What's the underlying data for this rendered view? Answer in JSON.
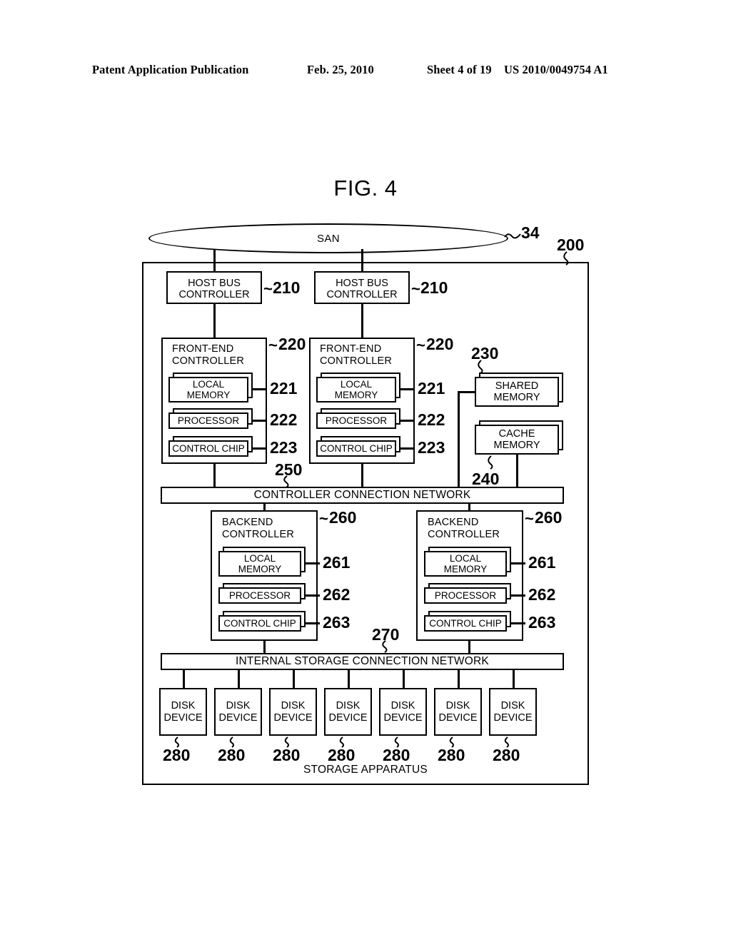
{
  "header": {
    "publication": "Patent Application Publication",
    "date": "Feb. 25, 2010",
    "sheet": "Sheet 4 of 19",
    "patent_number": "US 2010/0049754 A1"
  },
  "figure": {
    "title": "FIG. 4",
    "network_label": "SAN",
    "network_ref": "34",
    "apparatus_ref": "200",
    "apparatus_caption": "STORAGE APPARATUS"
  },
  "host_bus_controllers": [
    {
      "label": "HOST BUS\nCONTROLLER",
      "line1": "HOST BUS",
      "line2": "CONTROLLER",
      "ref": "210"
    },
    {
      "label": "HOST BUS\nCONTROLLER",
      "line1": "HOST BUS",
      "line2": "CONTROLLER",
      "ref": "210"
    }
  ],
  "front_end_controllers": [
    {
      "line1": "FRONT-END",
      "line2": "CONTROLLER",
      "ref": "220",
      "modules": [
        {
          "line1": "LOCAL",
          "line2": "MEMORY",
          "ref": "221"
        },
        {
          "line1": "PROCESSOR",
          "line2": "",
          "ref": "222"
        },
        {
          "line1": "CONTROL CHIP",
          "line2": "",
          "ref": "223"
        }
      ]
    },
    {
      "line1": "FRONT-END",
      "line2": "CONTROLLER",
      "ref": "220",
      "modules": [
        {
          "line1": "LOCAL",
          "line2": "MEMORY",
          "ref": "221"
        },
        {
          "line1": "PROCESSOR",
          "line2": "",
          "ref": "222"
        },
        {
          "line1": "CONTROL CHIP",
          "line2": "",
          "ref": "223"
        }
      ]
    }
  ],
  "memories": [
    {
      "line1": "SHARED",
      "line2": "MEMORY",
      "ref": "230"
    },
    {
      "line1": "CACHE",
      "line2": "MEMORY",
      "ref": "240"
    }
  ],
  "controller_network": {
    "label": "CONTROLLER CONNECTION NETWORK",
    "ref": "250"
  },
  "backend_controllers": [
    {
      "line1": "BACKEND",
      "line2": "CONTROLLER",
      "ref": "260",
      "modules": [
        {
          "line1": "LOCAL",
          "line2": "MEMORY",
          "ref": "261"
        },
        {
          "line1": "PROCESSOR",
          "line2": "",
          "ref": "262"
        },
        {
          "line1": "CONTROL CHIP",
          "line2": "",
          "ref": "263"
        }
      ]
    },
    {
      "line1": "BACKEND",
      "line2": "CONTROLLER",
      "ref": "260",
      "modules": [
        {
          "line1": "LOCAL",
          "line2": "MEMORY",
          "ref": "261"
        },
        {
          "line1": "PROCESSOR",
          "line2": "",
          "ref": "262"
        },
        {
          "line1": "CONTROL CHIP",
          "line2": "",
          "ref": "263"
        }
      ]
    }
  ],
  "storage_network": {
    "label": "INTERNAL STORAGE CONNECTION NETWORK",
    "ref": "270"
  },
  "disk_devices": [
    {
      "line1": "DISK",
      "line2": "DEVICE",
      "ref": "280"
    },
    {
      "line1": "DISK",
      "line2": "DEVICE",
      "ref": "280"
    },
    {
      "line1": "DISK",
      "line2": "DEVICE",
      "ref": "280"
    },
    {
      "line1": "DISK",
      "line2": "DEVICE",
      "ref": "280"
    },
    {
      "line1": "DISK",
      "line2": "DEVICE",
      "ref": "280"
    },
    {
      "line1": "DISK",
      "line2": "DEVICE",
      "ref": "280"
    },
    {
      "line1": "DISK",
      "line2": "DEVICE",
      "ref": "280"
    }
  ],
  "colors": {
    "ink": "#000000",
    "paper": "#ffffff"
  }
}
